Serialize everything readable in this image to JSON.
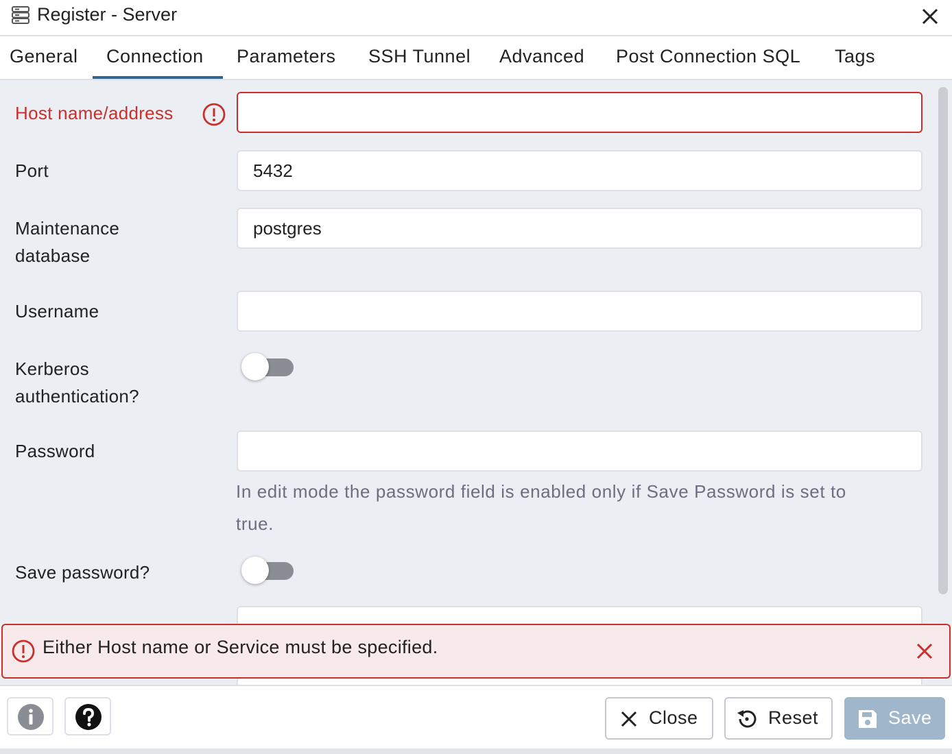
{
  "window": {
    "title": "Register - Server",
    "icon": "server-icon",
    "close_icon": "close-icon"
  },
  "tabs": [
    {
      "label": "General"
    },
    {
      "label": "Connection",
      "active": true
    },
    {
      "label": "Parameters"
    },
    {
      "label": "SSH Tunnel"
    },
    {
      "label": "Advanced"
    },
    {
      "label": "Post Connection SQL"
    },
    {
      "label": "Tags"
    }
  ],
  "form": {
    "host": {
      "label": "Host name/address",
      "value": "",
      "error": true
    },
    "port": {
      "label": "Port",
      "value": "5432"
    },
    "maintenance_db": {
      "label_line1": "Maintenance",
      "label_line2": "database",
      "value": "postgres"
    },
    "username": {
      "label": "Username",
      "value": ""
    },
    "kerberos": {
      "label_line1": "Kerberos",
      "label_line2": "authentication?",
      "on": false
    },
    "password": {
      "label": "Password",
      "value": "",
      "help_line1": "In edit mode the password field is enabled only if Save Password is set to",
      "help_line2": "true."
    },
    "save_password": {
      "label": "Save password?",
      "on": false
    }
  },
  "error_banner": {
    "message": "Either Host name or Service must be specified.",
    "color": "#c9302c"
  },
  "footer": {
    "info_icon": "info-icon",
    "help_icon": "help-icon",
    "close_label": "Close",
    "reset_label": "Reset",
    "save_label": "Save"
  },
  "colors": {
    "accent": "#326690",
    "error": "#c9302c",
    "form_bg": "#ebeef3",
    "save_disabled": "#9fb6cb"
  }
}
